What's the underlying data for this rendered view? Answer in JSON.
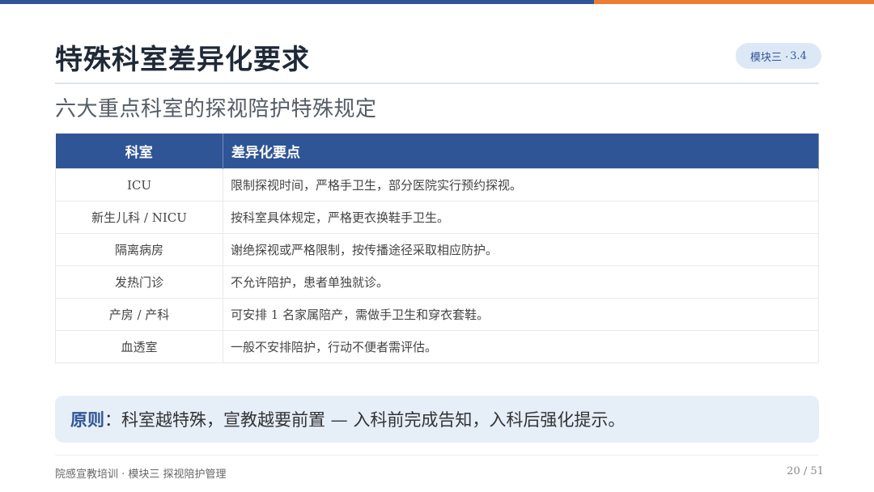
{
  "header": {
    "title": "特殊科室差异化要求",
    "badge_text": "模块三 · ",
    "badge_num": "3.4"
  },
  "subtitle": "六大重点科室的探视陪护特殊规定",
  "table": {
    "headers": [
      "科室",
      "差异化要点"
    ],
    "rows": [
      {
        "dept": "ICU",
        "point": "限制探视时间，严格手卫生，部分医院实行预约探视。"
      },
      {
        "dept": "新生儿科 / NICU",
        "point": "按科室具体规定，严格更衣换鞋手卫生。"
      },
      {
        "dept": "隔离病房",
        "point": "谢绝探视或严格限制，按传播途径采取相应防护。"
      },
      {
        "dept": "发热门诊",
        "point": "不允许陪护，患者单独就诊。"
      },
      {
        "dept": "产房 / 产科",
        "point": "可安排 1 名家属陪产，需做手卫生和穿衣套鞋。"
      },
      {
        "dept": "血透室",
        "point": "一般不安排陪护，行动不便者需评估。"
      }
    ]
  },
  "principle": {
    "label": "原则",
    "text": "：科室越特殊，宣教越要前置 — 入科前完成告知，入科后强化提示。"
  },
  "footer": {
    "left": "院感宣教培训 · 模块三 探视陪护管理",
    "page": "20 / 51"
  },
  "colors": {
    "primary": "#2f5597",
    "accent": "#ed7d31",
    "principle_bg": "#e6eef8"
  }
}
